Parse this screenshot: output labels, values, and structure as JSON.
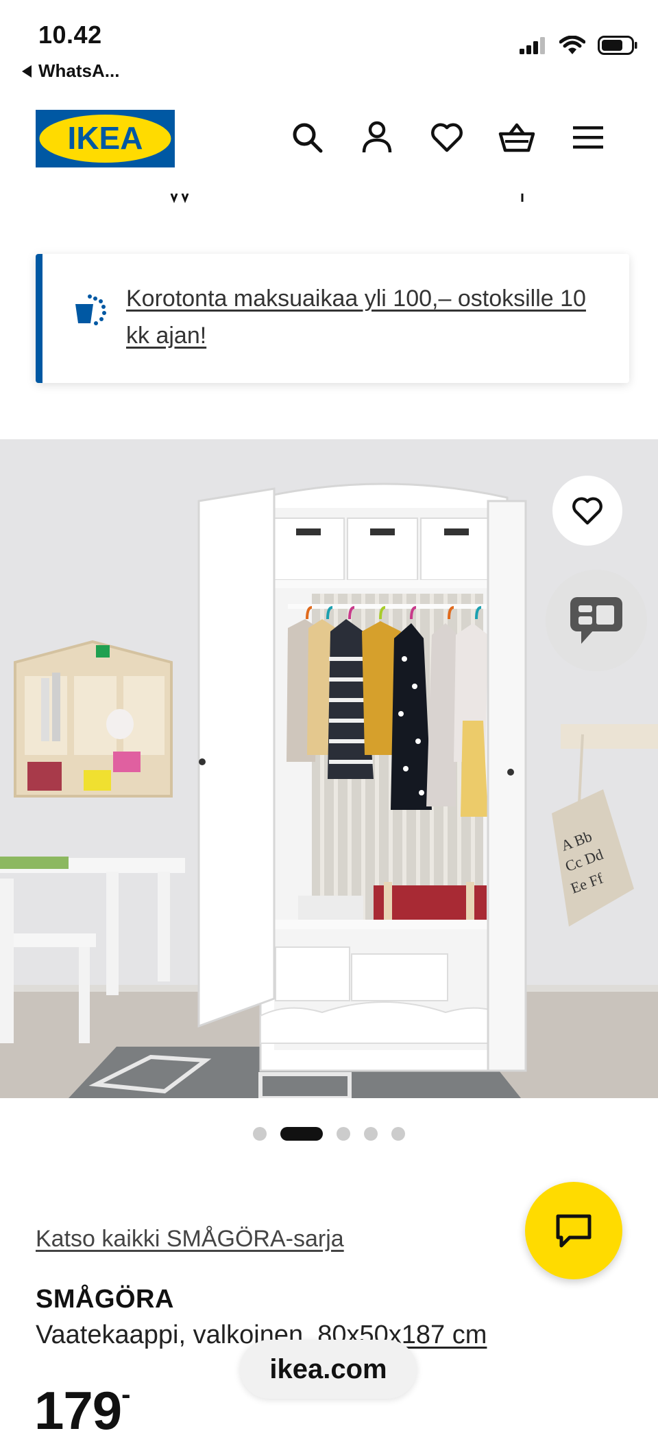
{
  "status_bar": {
    "time": "10.42",
    "back_app": "WhatsA..."
  },
  "header": {
    "logo_text": "IKEA",
    "icons": [
      "search-icon",
      "account-icon",
      "heart-icon",
      "basket-icon",
      "menu-icon"
    ]
  },
  "banner": {
    "text": "Korotonta maksuaikaa yli 100,– ostoksille 10 kk ajan!",
    "icon": "payment-plan-icon"
  },
  "gallery": {
    "current_index": 2,
    "total": 5,
    "favourite_icon": "heart-icon",
    "review_icon": "chat-bubble-icon"
  },
  "product": {
    "series_link": "Katso kaikki SMÅGÖRA-sarja",
    "name": "SMÅGÖRA",
    "desc_prefix": "Vaatekaappi, valkoinen, ",
    "dimensions": "80x50x187 cm",
    "price": "179",
    "price_suffix": "-"
  },
  "browser": {
    "url": "ikea.com"
  },
  "colors": {
    "ikea_blue": "#0058a3",
    "ikea_yellow": "#ffdb00"
  }
}
